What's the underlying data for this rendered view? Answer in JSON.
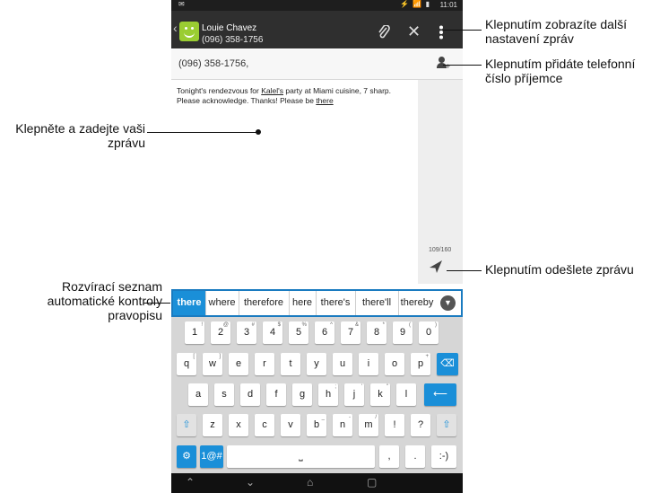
{
  "status_bar": {
    "time": "11:01",
    "icons": "⚡ 📶 ▮",
    "left_icon": "✉"
  },
  "conversation": {
    "contact_name": "Louie Chavez",
    "contact_number": "(096) 358-1756"
  },
  "toolbar": {
    "attach_icon": "paperclip-icon",
    "discard_icon": "close-icon",
    "menu_icon": "overflow-menu-icon"
  },
  "recipients": {
    "value": "(096) 358-1756,"
  },
  "message": {
    "text_before": "Tonight's rendezvous for ",
    "underlined_1": "Kalel's",
    "text_middle": " party at Miami cuisine, 7 sharp. Please acknowledge. Thanks! Please be ",
    "underlined_2": "there"
  },
  "counter": "109/160",
  "suggestions": [
    "there",
    "where",
    "therefore",
    "here",
    "there's",
    "there'll",
    "thereby"
  ],
  "keyboard": {
    "row1": [
      [
        "1",
        "!"
      ],
      [
        "2",
        "@"
      ],
      [
        "3",
        "#"
      ],
      [
        "4",
        "$"
      ],
      [
        "5",
        "%"
      ],
      [
        "6",
        "^"
      ],
      [
        "7",
        "&"
      ],
      [
        "8",
        "*"
      ],
      [
        "9",
        "("
      ],
      [
        "0",
        ")"
      ]
    ],
    "row2": [
      [
        "q",
        "["
      ],
      [
        "w",
        "]"
      ],
      [
        "e",
        ""
      ],
      [
        "r",
        ""
      ],
      [
        "t",
        ""
      ],
      [
        "y",
        ""
      ],
      [
        "u",
        ""
      ],
      [
        "i",
        ""
      ],
      [
        "o",
        ""
      ],
      [
        "p",
        "+"
      ]
    ],
    "row3": [
      [
        "a",
        ""
      ],
      [
        "s",
        ""
      ],
      [
        "d",
        ""
      ],
      [
        "f",
        ""
      ],
      [
        "g",
        ""
      ],
      [
        "h",
        ";"
      ],
      [
        "j",
        "'"
      ],
      [
        "k",
        "\""
      ],
      [
        "l",
        ""
      ]
    ],
    "row4": [
      [
        "z",
        ""
      ],
      [
        "x",
        ""
      ],
      [
        "c",
        ""
      ],
      [
        "v",
        ""
      ],
      [
        "b",
        "_"
      ],
      [
        "n",
        "-"
      ],
      [
        "m",
        "/"
      ],
      [
        "!",
        ""
      ],
      [
        "?",
        ""
      ]
    ],
    "sym_label": "1@#",
    "space_label": "⎵",
    "comma": ",",
    "period": ".",
    "smiley": ":-)",
    "shift_glyph": "⇧",
    "enter_glyph": "⟵",
    "settings_glyph": "⚙",
    "backspace_glyph": "⌫"
  },
  "navigation": {
    "back": "⌃",
    "home": "⌂",
    "down": "⌄",
    "recent": "▢"
  },
  "annotations": {
    "settings": "Klepnutím zobrazíte další nastavení zpráv",
    "add_recipient": "Klepnutím přidáte telefonní číslo příjemce",
    "type_message": "Klepněte a zadejte vaši zprávu",
    "send": "Klepnutím odešlete zprávu",
    "autocorrect": "Rozvírací seznam automatické kontroly pravopisu"
  },
  "colors": {
    "accent": "#1a8fd8",
    "titlebar": "#2f2f2f",
    "avatar": "#9acd32"
  }
}
